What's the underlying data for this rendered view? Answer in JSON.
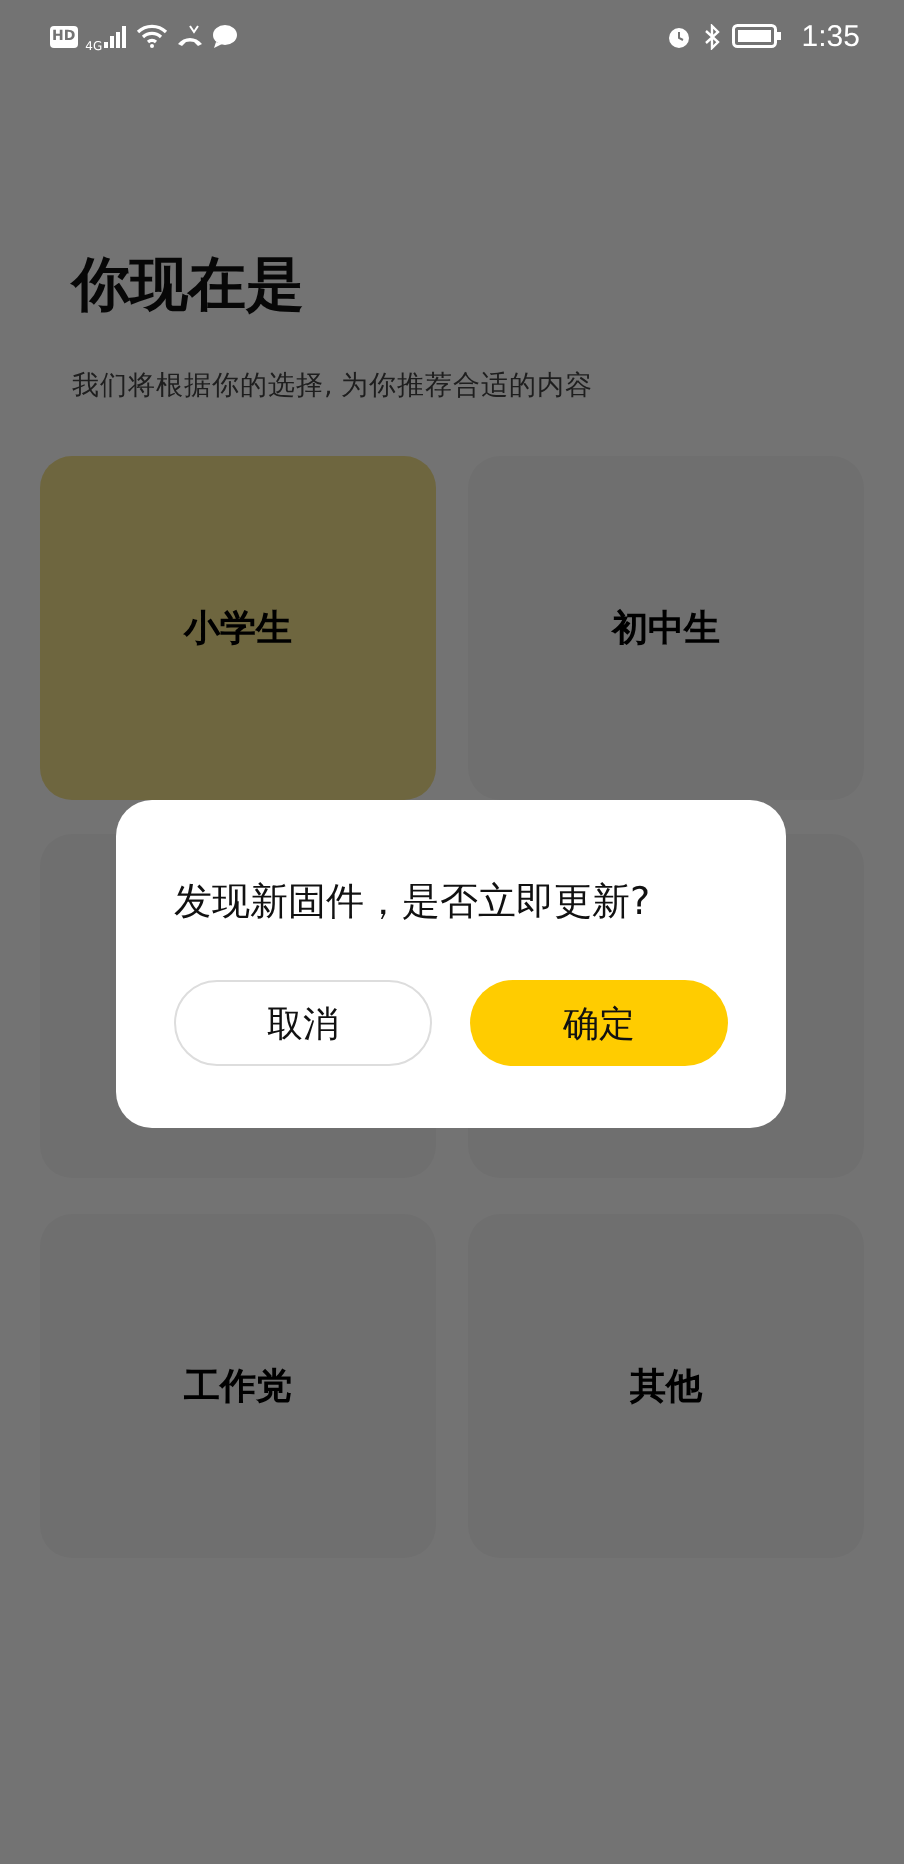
{
  "status_bar": {
    "hd": "HD",
    "network": "4G",
    "time": "1:35"
  },
  "header": {
    "title": "你现在是",
    "subtitle": "我们将根据你的选择, 为你推荐合适的内容"
  },
  "options": [
    {
      "label": "小学生",
      "selected": true
    },
    {
      "label": "初中生",
      "selected": false
    },
    {
      "selected": false
    },
    {
      "selected": false
    },
    {
      "label": "工作党",
      "selected": false
    },
    {
      "label": "其他",
      "selected": false
    }
  ],
  "dialog": {
    "message": "发现新固件，是否立即更新?",
    "buttons": [
      {
        "label": "取消",
        "kind": "secondary"
      },
      {
        "label": "确定",
        "kind": "primary"
      }
    ]
  }
}
